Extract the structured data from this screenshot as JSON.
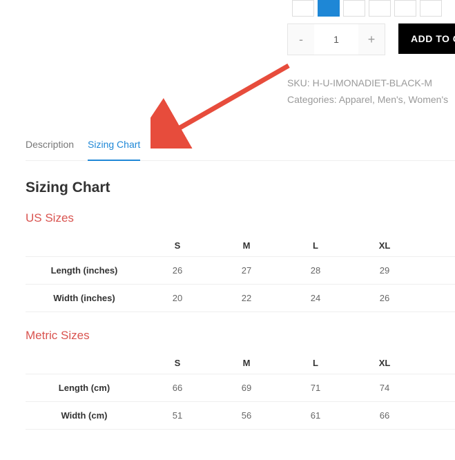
{
  "buy": {
    "minus": "-",
    "plus": "+",
    "qty": "1",
    "add": "ADD TO CART"
  },
  "meta": {
    "sku_label": "SKU:",
    "sku": "H-U-IMONADIET-BLACK-M",
    "cat_label": "Categories:",
    "cat1": "Apparel",
    "cat2": "Men's",
    "cat3": "Women's"
  },
  "tabs": {
    "desc": "Description",
    "chart": "Sizing Chart"
  },
  "heading": "Sizing Chart",
  "us": {
    "title": "US Sizes",
    "row1": "Length (inches)",
    "row2": "Width (inches)"
  },
  "metric": {
    "title": "Metric Sizes",
    "row1": "Length (cm)",
    "row2": "Width (cm)"
  },
  "cols": {
    "s": "S",
    "m": "M",
    "l": "L",
    "xl": "XL"
  },
  "chart_data": [
    {
      "type": "table",
      "title": "US Sizes",
      "categories": [
        "S",
        "M",
        "L",
        "XL"
      ],
      "series": [
        {
          "name": "Length (inches)",
          "values": [
            26,
            27,
            28,
            29
          ]
        },
        {
          "name": "Width (inches)",
          "values": [
            20,
            22,
            24,
            26
          ]
        }
      ]
    },
    {
      "type": "table",
      "title": "Metric Sizes",
      "categories": [
        "S",
        "M",
        "L",
        "XL"
      ],
      "series": [
        {
          "name": "Length (cm)",
          "values": [
            66,
            69,
            71,
            74
          ]
        },
        {
          "name": "Width (cm)",
          "values": [
            51,
            56,
            61,
            66
          ]
        }
      ]
    }
  ]
}
